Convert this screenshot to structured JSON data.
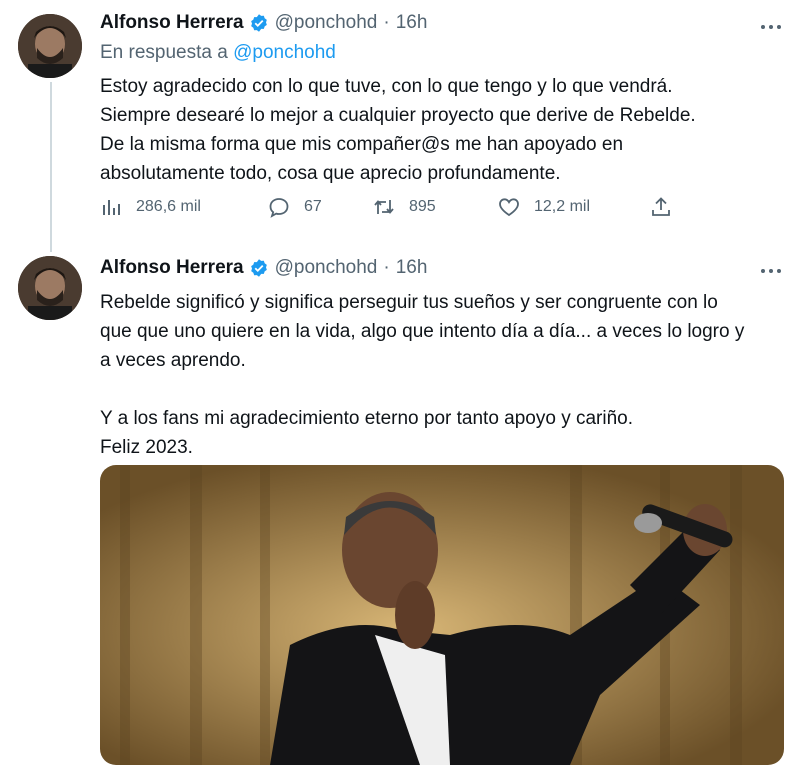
{
  "tweets": [
    {
      "author": "Alfonso Herrera",
      "handle": "@ponchohd",
      "time": "16h",
      "reply_prefix": "En respuesta a",
      "reply_mention": "@ponchohd",
      "lines": [
        "Estoy agradecido con lo que tuve, con lo que tengo y lo que vendrá.",
        "Siempre desearé lo mejor a cualquier proyecto que derive de Rebelde.",
        "De la misma forma que mis compañer@s me han apoyado en",
        "absolutamente todo, cosa que aprecio profundamente."
      ],
      "stats": {
        "views": "286,6 mil",
        "replies": "67",
        "retweets": "895",
        "likes": "12,2 mil"
      }
    },
    {
      "author": "Alfonso Herrera",
      "handle": "@ponchohd",
      "time": "16h",
      "lines": [
        "Rebelde significó y significa perseguir tus sueños y ser congruente con lo",
        "que que uno quiere en la vida, algo que intento día a día... a veces lo logro y",
        "a veces aprendo.",
        "",
        "Y a los fans mi agradecimiento eterno por tanto apoyo y cariño.",
        "Feliz 2023."
      ]
    }
  ],
  "colors": {
    "text": "#0f1419",
    "secondary": "#536471",
    "accent": "#1d9bf0",
    "thread_line": "#cfd9de"
  },
  "icons": [
    "verified-badge-icon",
    "more-icon",
    "views-icon",
    "reply-icon",
    "retweet-icon",
    "like-icon",
    "share-icon"
  ]
}
